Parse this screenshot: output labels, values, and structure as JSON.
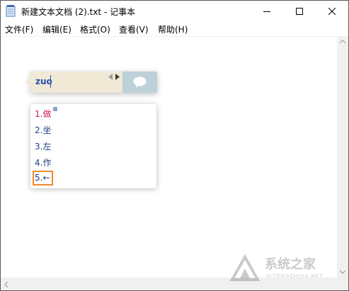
{
  "window": {
    "title": "新建文本文档 (2).txt - 记事本"
  },
  "menu": {
    "items": [
      "文件(F)",
      "编辑(E)",
      "格式(O)",
      "查看(V)",
      "帮助(H)"
    ]
  },
  "ime": {
    "composition": "zuo",
    "candidates": [
      "1.做",
      "2.坐",
      "3.左",
      "4.作",
      "5.←"
    ],
    "highlighted_index": 5
  },
  "watermark": {
    "text": "系统之家",
    "subtext": "XITONGZHIJIA.NET"
  },
  "colors": {
    "ime_bar_bg": "#efe9d6",
    "ime_panel_bg": "#bdd1d9",
    "candidate_first": "#d4175a",
    "candidate_text": "#1f3f80",
    "highlight_border": "#f0882a"
  },
  "icons": {
    "app": "notepad-icon",
    "minimize": "minimize-icon",
    "maximize": "maximize-icon",
    "close": "close-icon",
    "page_prev": "triangle-left-icon",
    "page_next": "triangle-right-icon",
    "ime_panel": "speech-bubble-icon"
  }
}
